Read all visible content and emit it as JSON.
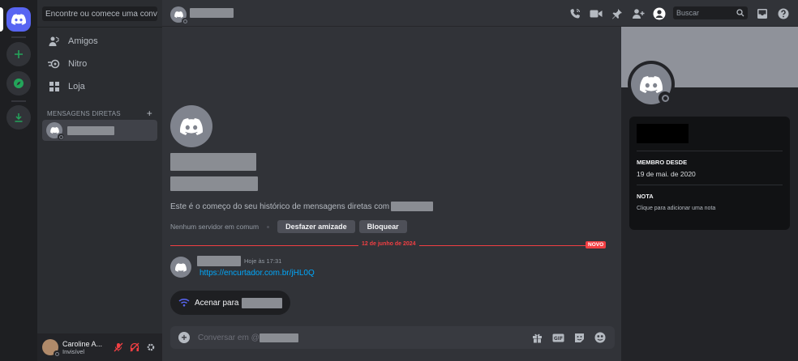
{
  "sidebar": {
    "search_placeholder": "Encontre ou comece uma conver...",
    "nav": [
      {
        "label": "Amigos",
        "icon": "friends-icon"
      },
      {
        "label": "Nitro",
        "icon": "nitro-icon"
      },
      {
        "label": "Loja",
        "icon": "shop-icon"
      }
    ],
    "dm_header": "MENSAGENS DIRETAS",
    "dm_add": "+"
  },
  "user": {
    "name": "Caroline A...",
    "status": "Invisível"
  },
  "topbar": {
    "search_placeholder": "Buscar"
  },
  "chat": {
    "intro_text": "Este é o começo do seu histórico de mensagens diretas com",
    "no_common_servers": "Nenhum servidor em comum",
    "unfriend_label": "Desfazer amizade",
    "block_label": "Bloquear",
    "date_divider": "12 de junho de 2024",
    "new_badge": "NOVO",
    "message": {
      "timestamp": "Hoje às 17:31",
      "link": "https://encurtador.com.br/jHL0Q"
    },
    "wave_label": "Acenar para",
    "composer_placeholder": "Conversar em @"
  },
  "profile": {
    "member_since_label": "MEMBRO DESDE",
    "member_since_value": "19 de mai. de 2020",
    "note_label": "NOTA",
    "note_placeholder": "Clique para adicionar uma nota"
  },
  "colors": {
    "accent": "#5865f2",
    "link": "#00a8fc",
    "danger": "#f23f43",
    "online_green": "#23a55a"
  }
}
